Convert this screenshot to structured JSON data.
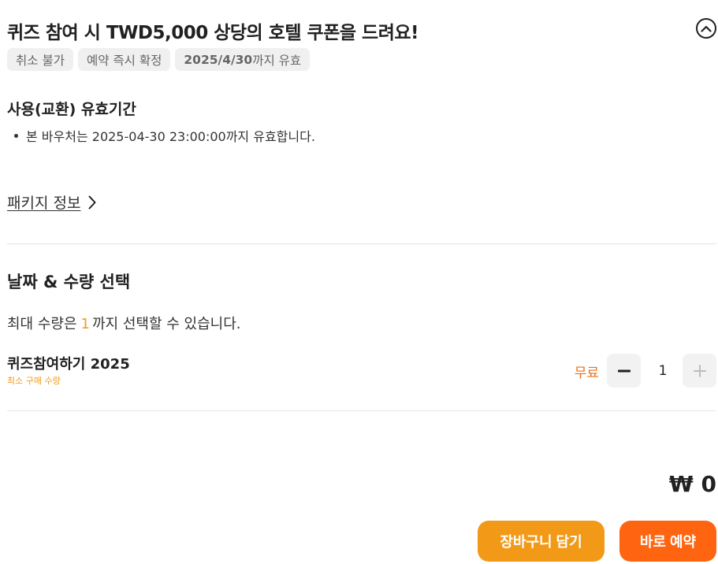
{
  "header": {
    "title": "퀴즈 참여 시 TWD5,000 상당의 호텔 쿠폰을 드려요!",
    "collapse_icon": "chevron-up-circle-icon"
  },
  "tags": [
    {
      "label": "취소 불가"
    },
    {
      "label": "예약 즉시 확정"
    },
    {
      "bold": "2025/4/30",
      "rest": "까지 유효"
    }
  ],
  "validity": {
    "title": "사용(교환) 유효기간",
    "bullet": "본 바우처는 2025-04-30 23:00:00까지 유효합니다."
  },
  "package_link": {
    "label": "패키지 정보",
    "icon": "chevron-right-icon"
  },
  "selection": {
    "title": "날짜 & 수량 선택",
    "max_prefix": "최대 수량은",
    "max_value": "1",
    "max_suffix": "까지 선택할 수 있습니다.",
    "item": {
      "name": "퀴즈참여하기 2025",
      "sub": "최소 구매 수량",
      "price": "무료",
      "quantity": "1"
    }
  },
  "total": "₩ 0",
  "actions": {
    "cart_label": "장바구니 담기",
    "book_label": "바로 예약"
  },
  "colors": {
    "accent_orange": "#f29a18",
    "primary_orange": "#ff6410",
    "price_orange": "#e8701a"
  }
}
